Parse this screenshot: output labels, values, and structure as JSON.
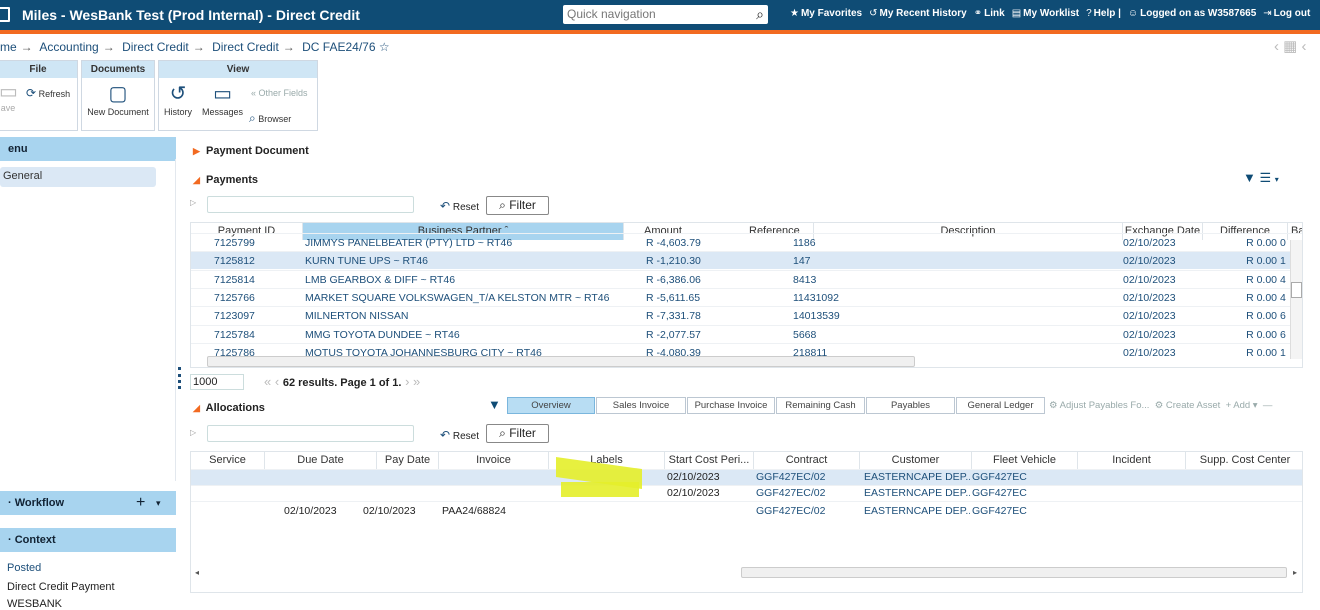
{
  "app": {
    "title": "Miles - WesBank Test (Prod Internal) - Direct Credit",
    "quick_nav_placeholder": "Quick navigation",
    "links": [
      "My Favorites",
      "My Recent History",
      "Link",
      "My Worklist",
      "Help |",
      "Logged on as W3587665",
      "Log out"
    ]
  },
  "breadcrumb": [
    "me",
    "Accounting",
    "Direct Credit",
    "Direct Credit",
    "DC FAE24/76"
  ],
  "ribbon": {
    "file": {
      "title": "File",
      "save": "ave",
      "refresh": "Refresh"
    },
    "documents": {
      "title": "Documents",
      "new_document": "New Document"
    },
    "view": {
      "title": "View",
      "history": "History",
      "messages": "Messages",
      "other_fields": "Other Fields",
      "browser": "Browser"
    }
  },
  "sidebar": {
    "menu_title": "enu",
    "menu_item": "General",
    "workflow_title": "Workflow",
    "context_title": "Context",
    "context_items": [
      "Posted",
      "Direct Credit Payment",
      "WESBANK"
    ]
  },
  "payment_document": {
    "title": "Payment Document"
  },
  "payments": {
    "title": "Payments",
    "reset": "Reset",
    "filter": "Filter",
    "columns": [
      "Payment ID",
      "Business Partner ˆ",
      "Amount",
      "Reference",
      "Description",
      "Exchange Date",
      "Difference",
      "Ba"
    ],
    "rows": [
      [
        "7125799",
        "JIMMYS PANELBEATER (PTY) LTD ~ RT46",
        "R -4,603.79",
        "1186",
        "",
        "02/10/2023",
        "R 0.00",
        "0"
      ],
      [
        "7125812",
        "KURN TUNE UPS ~ RT46",
        "R -1,210.30",
        "147",
        "",
        "02/10/2023",
        "R 0.00",
        "1"
      ],
      [
        "7125814",
        "LMB GEARBOX & DIFF ~ RT46",
        "R -6,386.06",
        "8413",
        "",
        "02/10/2023",
        "R 0.00",
        "4"
      ],
      [
        "7125766",
        "MARKET SQUARE VOLKSWAGEN_T/A KELSTON MTR ~ RT46",
        "R -5,611.65",
        "11431092",
        "",
        "02/10/2023",
        "R 0.00",
        "4"
      ],
      [
        "7123097",
        "MILNERTON NISSAN",
        "R -7,331.78",
        "14013539",
        "",
        "02/10/2023",
        "R 0.00",
        "6"
      ],
      [
        "7125784",
        "MMG TOYOTA DUNDEE ~ RT46",
        "R -2,077.57",
        "5668",
        "",
        "02/10/2023",
        "R 0.00",
        "6"
      ],
      [
        "7125786",
        "MOTUS TOYOTA JOHANNESBURG CITY ~ RT46",
        "R -4,080.39",
        "218811",
        "",
        "02/10/2023",
        "R 0.00",
        "1"
      ]
    ],
    "page_size": "1000",
    "results": "62 results. Page 1 of 1."
  },
  "allocations": {
    "title": "Allocations",
    "tabs": [
      "Overview",
      "Sales Invoice",
      "Purchase Invoice",
      "Remaining Cash",
      "Payables",
      "General Ledger"
    ],
    "actions": [
      "Adjust Payables Fo...",
      "Create Asset",
      "Add"
    ],
    "reset": "Reset",
    "filter": "Filter",
    "columns": [
      "Service",
      "Due Date",
      "Pay Date",
      "Invoice",
      "Labels",
      "Start Cost Peri...",
      "Contract",
      "Customer",
      "Fleet Vehicle",
      "Incident",
      "Supp. Cost Center"
    ],
    "rows": [
      [
        "",
        "",
        "",
        "",
        "",
        "02/10/2023",
        "GGF427EC/02",
        "EASTERNCAPE DEP...",
        "GGF427EC",
        "",
        ""
      ],
      [
        "",
        "",
        "",
        "",
        "",
        "02/10/2023",
        "GGF427EC/02",
        "EASTERNCAPE DEP...",
        "GGF427EC",
        "",
        ""
      ],
      [
        "",
        "02/10/2023",
        "02/10/2023",
        "PAA24/68824",
        "",
        "",
        "GGF427EC/02",
        "EASTERNCAPE DEP...",
        "GGF427EC",
        "",
        ""
      ]
    ]
  },
  "colors": {
    "topbar": "#0f4c75",
    "accent": "#f26a21",
    "highlight": "#e4ee2a",
    "link": "#1d4f7a"
  }
}
